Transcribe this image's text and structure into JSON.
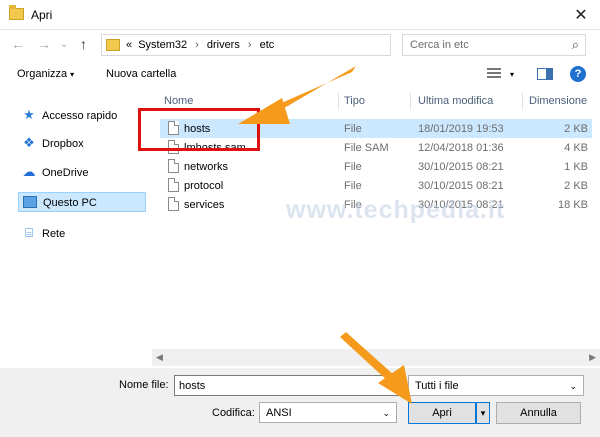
{
  "window": {
    "title": "Apri",
    "close_glyph": "✕"
  },
  "nav": {
    "back_glyph": "←",
    "forward_glyph": "→",
    "recent_glyph": "⌄",
    "up_glyph": "↑",
    "breadcrumb": [
      "«",
      "System32",
      "drivers",
      "etc"
    ],
    "breadcrumb_sep": "›",
    "refresh_glyph": "↻",
    "dropdown_glyph": "▾",
    "search_placeholder": "Cerca in etc",
    "search_glyph": "⌕"
  },
  "toolbar": {
    "organize_label": "Organizza",
    "new_folder_label": "Nuova cartella",
    "dropdown_glyph": "▾",
    "help_glyph": "?"
  },
  "sidebar": {
    "items": [
      {
        "label": "Accesso rapido",
        "icon": "star-icon",
        "glyph": "★"
      },
      {
        "label": "Dropbox",
        "icon": "dropbox-icon",
        "glyph": "❖"
      },
      {
        "label": "OneDrive",
        "icon": "cloud-icon",
        "glyph": "☁"
      },
      {
        "label": "Questo PC",
        "icon": "computer-icon",
        "glyph": ""
      },
      {
        "label": "Rete",
        "icon": "network-icon",
        "glyph": "⌸"
      }
    ]
  },
  "columns": {
    "name": "Nome",
    "type": "Tipo",
    "modified": "Ultima modifica",
    "size": "Dimensione"
  },
  "files": [
    {
      "name": "hosts",
      "type": "File",
      "modified": "18/01/2019 19:53",
      "size": "2 KB"
    },
    {
      "name": "lmhosts.sam",
      "type": "File SAM",
      "modified": "12/04/2018 01:36",
      "size": "4 KB"
    },
    {
      "name": "networks",
      "type": "File",
      "modified": "30/10/2015 08:21",
      "size": "1 KB"
    },
    {
      "name": "protocol",
      "type": "File",
      "modified": "30/10/2015 08:21",
      "size": "2 KB"
    },
    {
      "name": "services",
      "type": "File",
      "modified": "30/10/2015 08:21",
      "size": "18 KB"
    }
  ],
  "scroll": {
    "left_glyph": "◀",
    "right_glyph": "▶"
  },
  "bottom": {
    "filename_label": "Nome file:",
    "filename_value": "hosts",
    "filter_value": "Tutti i file",
    "encoding_label": "Codifica:",
    "encoding_value": "ANSI",
    "dropdown_glyph": "⌄",
    "open_label": "Apri",
    "split_glyph": "▾",
    "cancel_label": "Annulla"
  },
  "watermark": "www.techpedia.it",
  "colors": {
    "selection": "#cce8ff",
    "highlight_box": "#e01010",
    "arrow": "#f59a1b"
  }
}
